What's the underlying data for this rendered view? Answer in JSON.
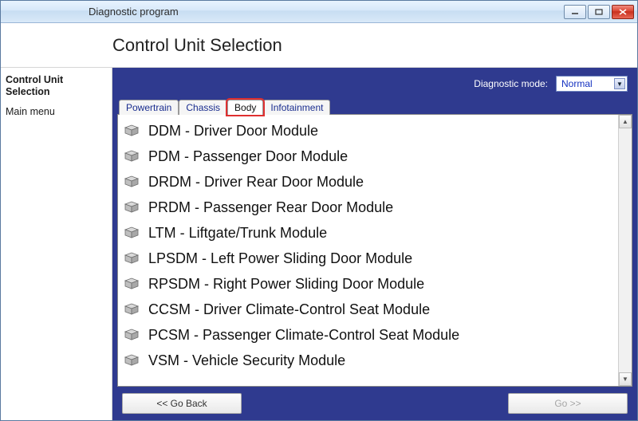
{
  "window": {
    "title": "Diagnostic program"
  },
  "header": {
    "title": "Control Unit Selection"
  },
  "sidebar": {
    "items": [
      {
        "label": "Control Unit Selection",
        "bold": true
      },
      {
        "label": "Main menu",
        "bold": false
      }
    ]
  },
  "diag_mode": {
    "label": "Diagnostic mode:",
    "value": "Normal"
  },
  "tabs": [
    {
      "label": "Powertrain",
      "active": false
    },
    {
      "label": "Chassis",
      "active": false
    },
    {
      "label": "Body",
      "active": true
    },
    {
      "label": "Infotainment",
      "active": false
    }
  ],
  "modules": [
    {
      "label": "DDM - Driver Door Module"
    },
    {
      "label": "PDM - Passenger Door Module"
    },
    {
      "label": "DRDM - Driver Rear Door Module"
    },
    {
      "label": "PRDM - Passenger Rear Door Module"
    },
    {
      "label": "LTM - Liftgate/Trunk Module"
    },
    {
      "label": "LPSDM - Left Power Sliding Door Module"
    },
    {
      "label": "RPSDM - Right Power Sliding Door Module"
    },
    {
      "label": "CCSM - Driver Climate-Control Seat Module"
    },
    {
      "label": "PCSM - Passenger Climate-Control Seat Module"
    },
    {
      "label": "VSM - Vehicle Security Module"
    }
  ],
  "buttons": {
    "back": "<< Go Back",
    "go": "Go >>"
  }
}
